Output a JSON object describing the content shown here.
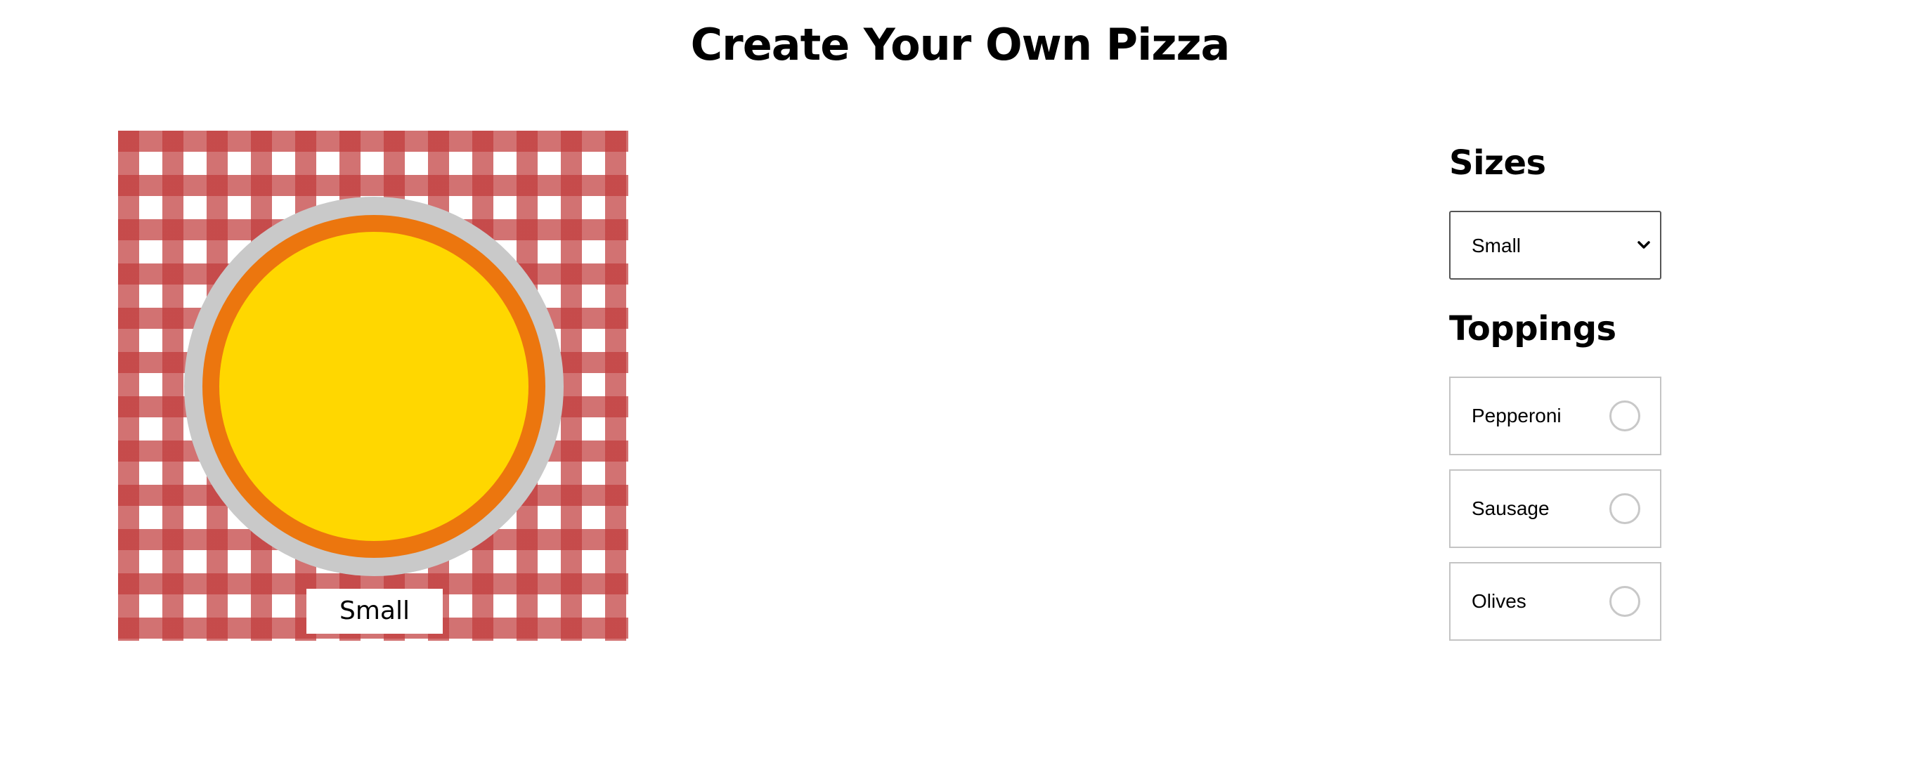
{
  "page": {
    "title": "Create Your Own Pizza"
  },
  "preview": {
    "size_label": "Small",
    "colors": {
      "tablecloth_stripe": "#c13c3c",
      "plate": "#c9c9c9",
      "crust": "#ec760e",
      "cheese": "#ffd700"
    }
  },
  "sizes": {
    "heading": "Sizes",
    "selected": "Small",
    "chevron_icon": "chevron-down-icon"
  },
  "toppings": {
    "heading": "Toppings",
    "items": [
      {
        "label": "Pepperoni",
        "checked": false
      },
      {
        "label": "Sausage",
        "checked": false
      },
      {
        "label": "Olives",
        "checked": false
      }
    ]
  }
}
